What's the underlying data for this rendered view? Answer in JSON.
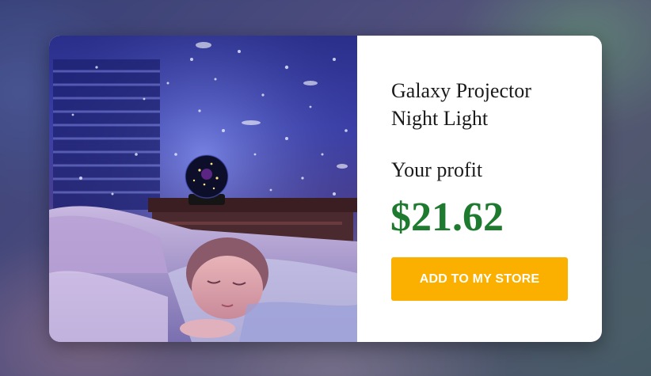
{
  "product": {
    "title": "Galaxy Projector Night Light",
    "profit_label": "Your profit",
    "profit_value": "$21.62",
    "image_alt": "child sleeping under galaxy projector night light"
  },
  "actions": {
    "add_label": "ADD TO MY STORE"
  },
  "colors": {
    "profit_green": "#1e7a2e",
    "button_yellow": "#fbb000",
    "card_bg": "#ffffff"
  }
}
